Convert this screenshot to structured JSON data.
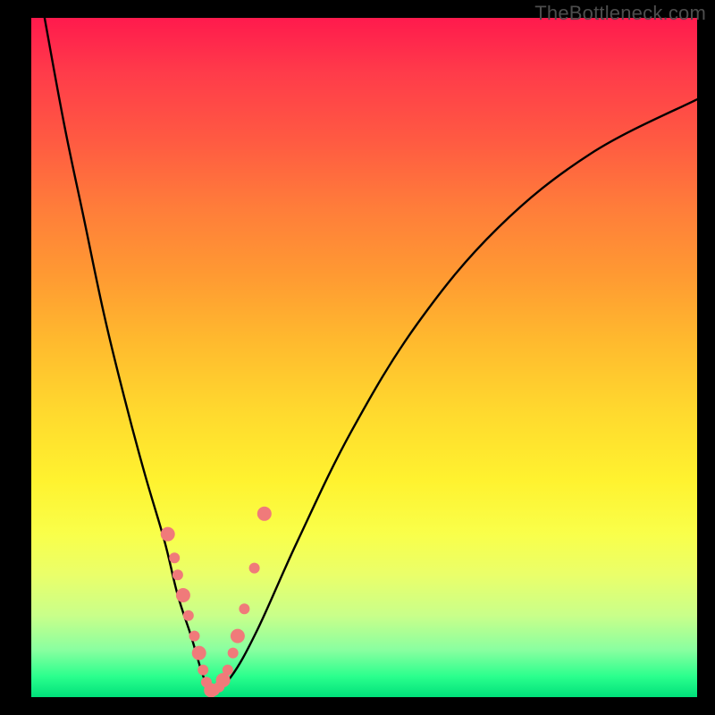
{
  "watermark": "TheBottleneck.com",
  "chart_data": {
    "type": "line",
    "title": "",
    "xlabel": "",
    "ylabel": "",
    "xlim": [
      0,
      100
    ],
    "ylim": [
      0,
      100
    ],
    "grid": false,
    "series": [
      {
        "name": "bottleneck-curve",
        "x": [
          2,
          5,
          8,
          11,
          14,
          17,
          20,
          22,
          24,
          25.5,
          26.5,
          27,
          30,
          34,
          40,
          48,
          58,
          70,
          84,
          100
        ],
        "y": [
          100,
          84,
          70,
          56,
          44,
          33,
          23,
          15,
          9,
          4,
          1.5,
          0.5,
          3,
          10,
          23,
          39,
          55,
          69,
          80,
          88
        ]
      }
    ],
    "markers": {
      "name": "highlight-dots",
      "color": "#f07a7a",
      "x": [
        20.5,
        21.5,
        22,
        22.8,
        23.6,
        24.5,
        25.2,
        25.8,
        26.3,
        27,
        27.5,
        28.2,
        28.8,
        29.5,
        30.3,
        31,
        32,
        33.5,
        35
      ],
      "y": [
        24,
        20.5,
        18,
        15,
        12,
        9,
        6.5,
        4,
        2.2,
        1,
        1,
        1.5,
        2.5,
        4,
        6.5,
        9,
        13,
        19,
        27
      ]
    },
    "background_gradient_stops": [
      {
        "pos": 0.0,
        "color": "#ff1a4d"
      },
      {
        "pos": 0.18,
        "color": "#ff5a42"
      },
      {
        "pos": 0.38,
        "color": "#ff9a32"
      },
      {
        "pos": 0.58,
        "color": "#ffd92e"
      },
      {
        "pos": 0.76,
        "color": "#f9ff4a"
      },
      {
        "pos": 0.88,
        "color": "#c9ff8a"
      },
      {
        "pos": 1.0,
        "color": "#00e07a"
      }
    ]
  }
}
